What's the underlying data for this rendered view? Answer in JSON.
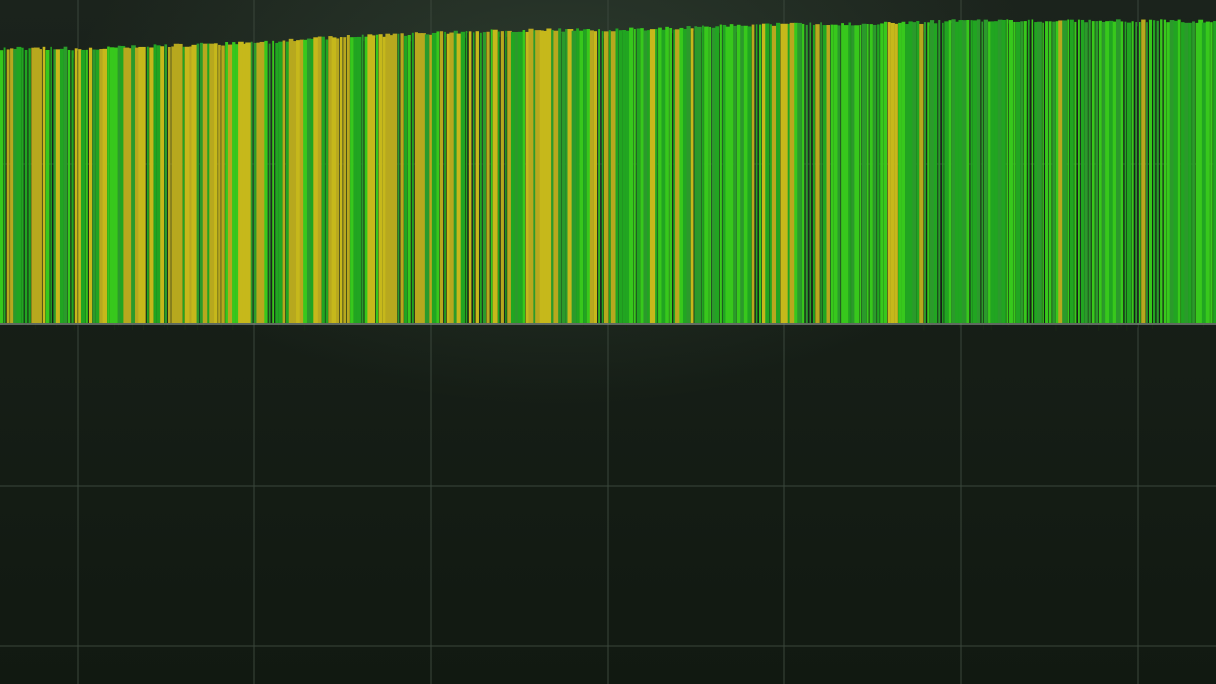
{
  "colors": {
    "background": "#141c14",
    "grid": "#3a463b",
    "baseline": "#8a968a",
    "bar_green_dark": "#2b9a2b",
    "bar_green": "#21a521",
    "bar_green_bright": "#37c81c",
    "bar_yellow": "#b7a81e",
    "bar_yellow_bright": "#c6b81b"
  },
  "spectrum": {
    "bar_count": 340,
    "level_profile": [
      0.9,
      0.9,
      0.91,
      0.92,
      0.94,
      0.95,
      0.96,
      0.96,
      0.97,
      0.98,
      0.98,
      0.99,
      0.99,
      0.99,
      0.99
    ],
    "yellow_density_profile": [
      0.3,
      0.5,
      0.55,
      0.55,
      0.5,
      0.42,
      0.3,
      0.28,
      0.15,
      0.12,
      0.1,
      0.08,
      0.05,
      0.05,
      0.06
    ]
  }
}
